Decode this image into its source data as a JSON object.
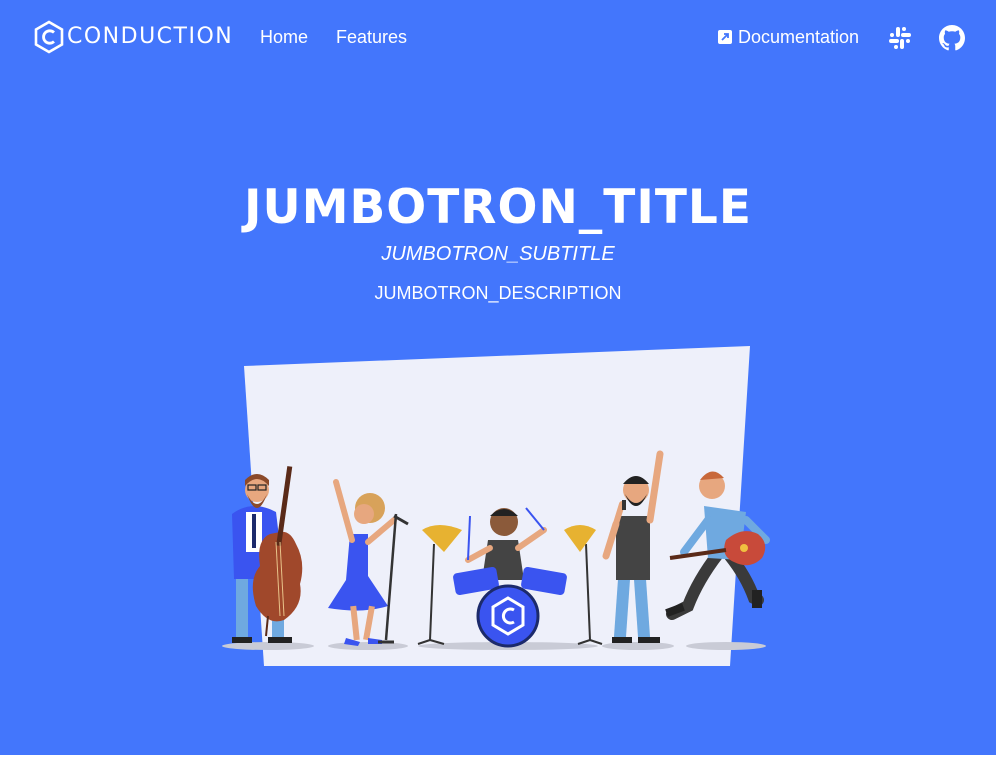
{
  "brand": {
    "name": "CONDUCTION",
    "logo_icon": "conduction-logo-icon"
  },
  "nav": {
    "home": "Home",
    "features": "Features",
    "documentation": "Documentation",
    "documentation_icon": "external-link-icon",
    "slack_icon": "slack-icon",
    "github_icon": "github-icon"
  },
  "jumbotron": {
    "title": "JUMBOTRON_TITLE",
    "subtitle": "JUMBOTRON_SUBTITLE",
    "description": "JUMBOTRON_DESCRIPTION",
    "illustration": "band-illustration"
  },
  "colors": {
    "primary": "#4376fc",
    "text": "#ffffff",
    "panel": "#eef0fa"
  }
}
